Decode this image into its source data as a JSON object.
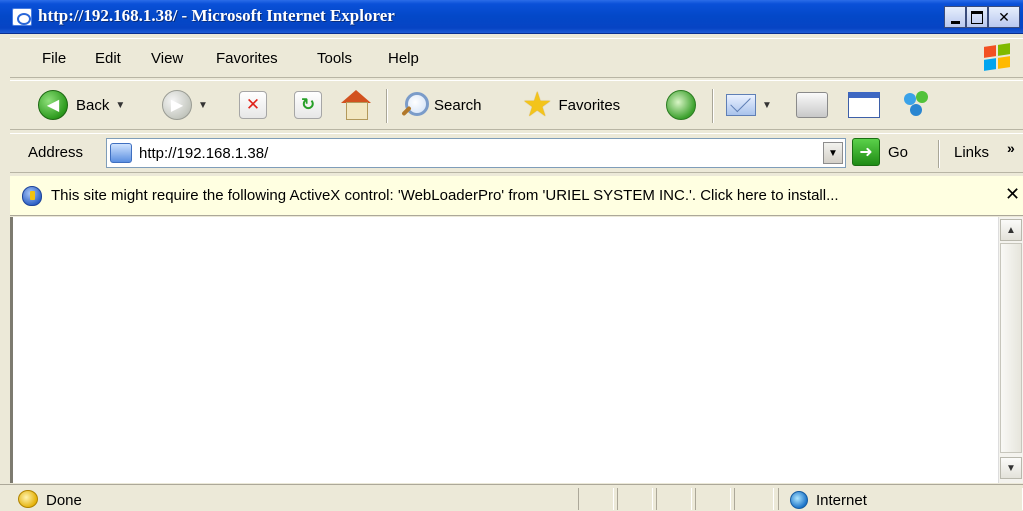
{
  "window": {
    "title": "http://192.168.1.38/ - Microsoft Internet Explorer"
  },
  "menu": {
    "items": [
      "File",
      "Edit",
      "View",
      "Favorites",
      "Tools",
      "Help"
    ]
  },
  "toolbar": {
    "back_label": "Back",
    "search_label": "Search",
    "favorites_label": "Favorites"
  },
  "address": {
    "label": "Address",
    "url": "http://192.168.1.38/",
    "go_label": "Go",
    "links_label": "Links",
    "links_chevron": "»"
  },
  "infobar": {
    "message": "This site might require the following ActiveX control: 'WebLoaderPro' from 'URIEL SYSTEM INC.'. Click here to install...",
    "close_glyph": "✕"
  },
  "status": {
    "text": "Done",
    "zone": "Internet"
  },
  "colors": {
    "titlebar": "#0348c8",
    "chrome": "#ece9d8",
    "infobar": "#ffffe1"
  }
}
